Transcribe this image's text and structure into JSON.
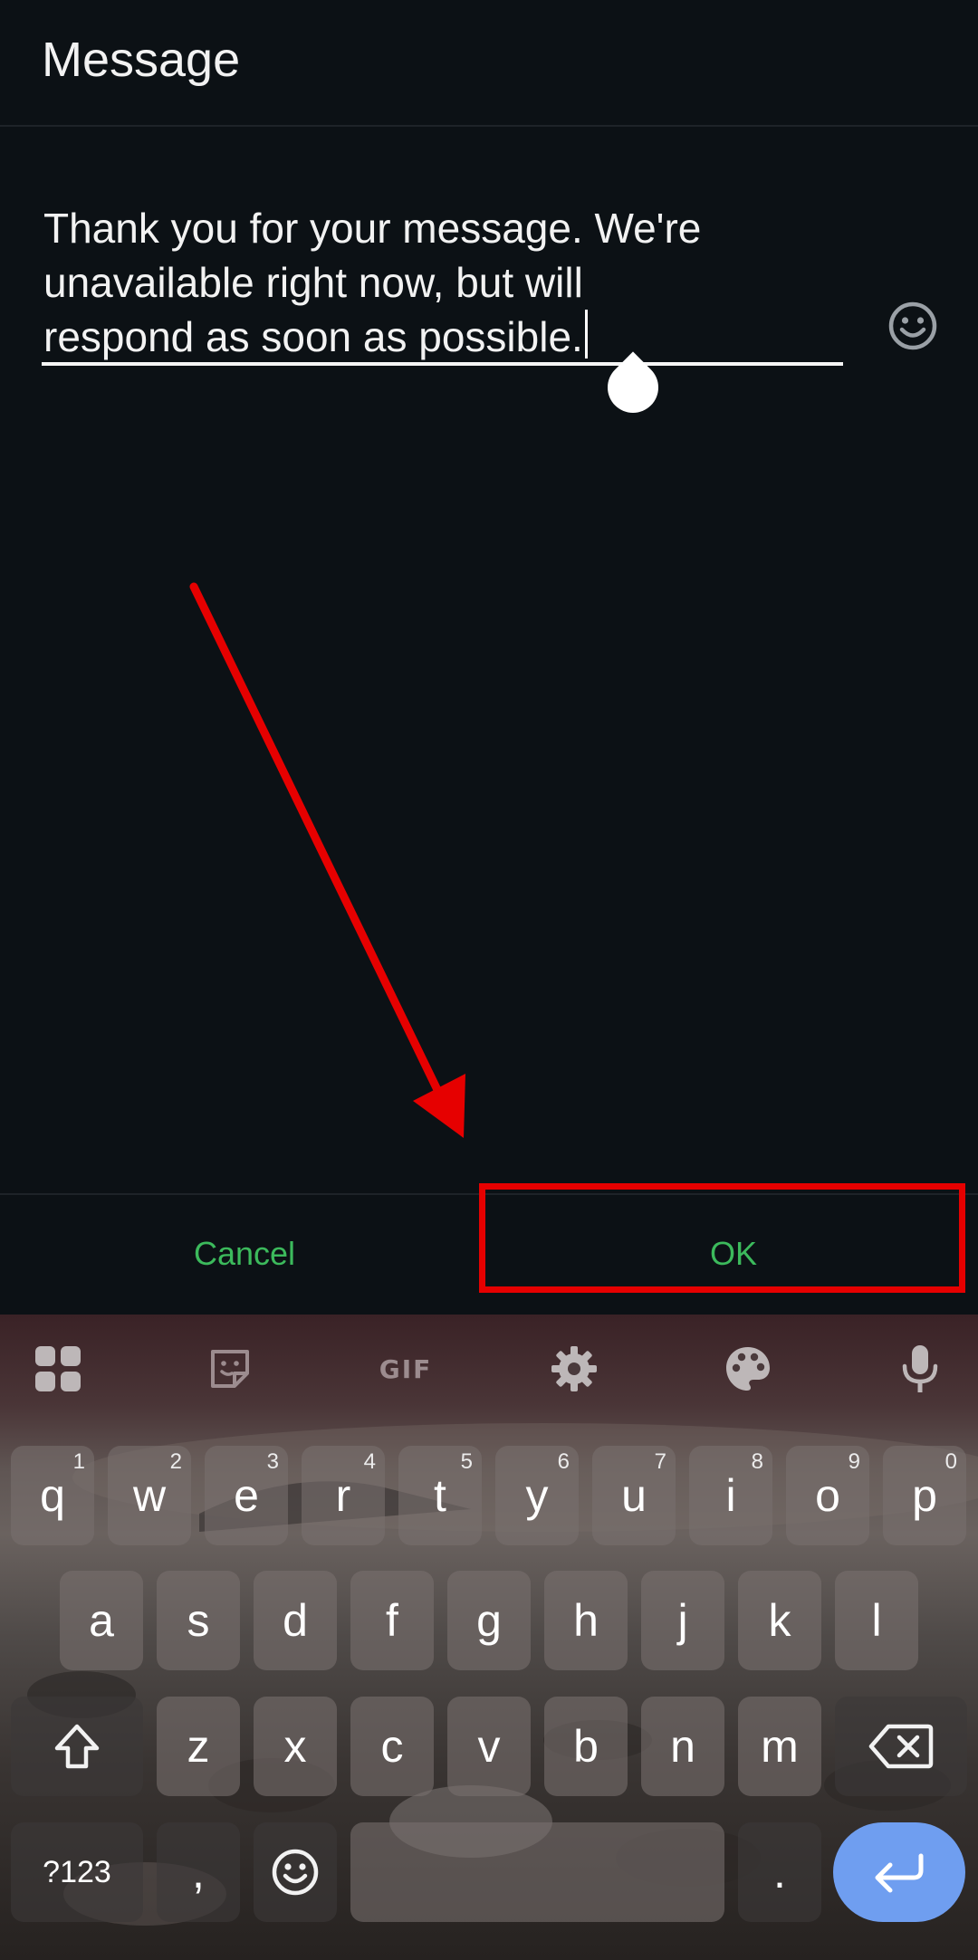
{
  "dialog": {
    "title": "Message",
    "message_value": "Thank you for your message. We're unavailable right now, but will respond as soon as possible.",
    "message_lines": [
      "Thank you for your message. We're",
      "unavailable right now, but will",
      "respond as soon as possible."
    ],
    "cancel_label": "Cancel",
    "ok_label": "OK",
    "accent_color": "#3cba5c"
  },
  "annotation": {
    "highlight_color": "#e60000",
    "highlighted_target": "ok-button"
  },
  "keyboard": {
    "toolbar": [
      "apps-grid-icon",
      "sticker-icon",
      "GIF",
      "settings-gear-icon",
      "theme-palette-icon",
      "microphone-icon"
    ],
    "gif_label": "GIF",
    "row1": [
      {
        "key": "q",
        "hint": "1"
      },
      {
        "key": "w",
        "hint": "2"
      },
      {
        "key": "e",
        "hint": "3"
      },
      {
        "key": "r",
        "hint": "4"
      },
      {
        "key": "t",
        "hint": "5"
      },
      {
        "key": "y",
        "hint": "6"
      },
      {
        "key": "u",
        "hint": "7"
      },
      {
        "key": "i",
        "hint": "8"
      },
      {
        "key": "o",
        "hint": "9"
      },
      {
        "key": "p",
        "hint": "0"
      }
    ],
    "row2": [
      "a",
      "s",
      "d",
      "f",
      "g",
      "h",
      "j",
      "k",
      "l"
    ],
    "row3": [
      "z",
      "x",
      "c",
      "v",
      "b",
      "n",
      "m"
    ],
    "symbols_label": "?123",
    "comma_label": ",",
    "period_label": ".",
    "enter_color": "#6f9ef0"
  }
}
